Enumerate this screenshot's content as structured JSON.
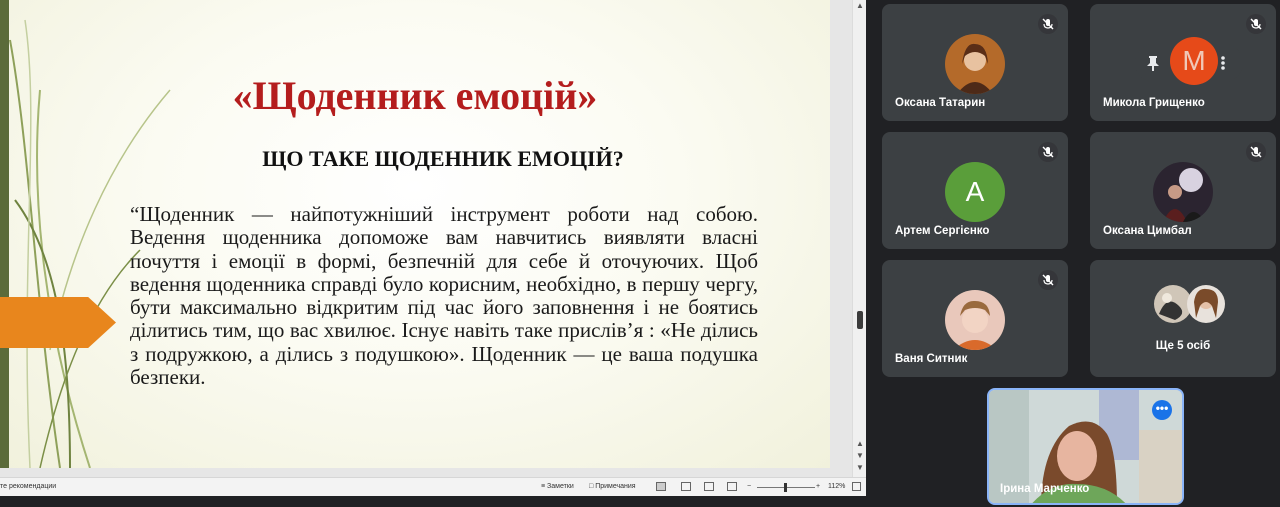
{
  "slide": {
    "title": "«Щоденник емоцій»",
    "subtitle": "ЩО ТАКЕ ЩОДЕННИК ЕМОЦІЙ?",
    "body": "“Щоденник — найпотужніший інструмент роботи над собою. Ведення щоденника допоможе вам навчитись виявляти власні почуття і емоції в формі, безпечній для себе й оточуючих. Щоб ведення щоденника справді було корисним, необхідно, в першу чергу, бути максимально відкритим під час його заповнення і не боятись ділитись тим, що вас хвилює. Існує навіть таке прислів’я : «Не ділись з подружкою, а ділись з подушкою». Щоденник — це ваша подушка безпеки.",
    "accent_color": "#e8861d",
    "title_color": "#b41d1d"
  },
  "statusbar": {
    "left_text": "те рекомендации",
    "notes_label": "Заметки",
    "comments_label": "Примечания",
    "zoom_minus": "−",
    "zoom_plus": "+",
    "zoom_value": "112%"
  },
  "participants": [
    {
      "name": "Оксана Татарин",
      "muted": true
    },
    {
      "name": "Микола Грищенко",
      "muted": true,
      "initial": "M"
    },
    {
      "name": "Артем Сергієнко",
      "muted": true,
      "initial": "A"
    },
    {
      "name": "Оксана Цимбал",
      "muted": true
    },
    {
      "name": "Ваня Ситник",
      "muted": true
    }
  ],
  "more_people": "Ще 5 осіб",
  "self": {
    "name": "Ірина Марченко",
    "more_icon": "•••"
  }
}
